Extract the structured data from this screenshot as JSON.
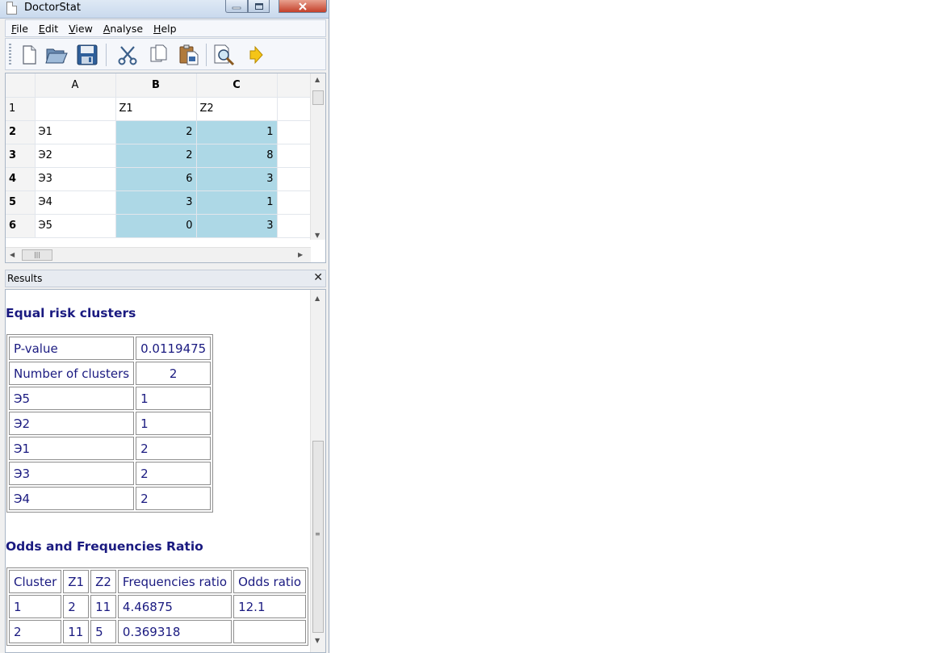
{
  "window": {
    "title": "DoctorStat"
  },
  "menu": {
    "items": [
      {
        "key": "F",
        "rest": "ile"
      },
      {
        "key": "E",
        "rest": "dit"
      },
      {
        "key": "V",
        "rest": "iew"
      },
      {
        "key": "A",
        "rest": "nalyse"
      },
      {
        "key": "H",
        "rest": "elp"
      }
    ]
  },
  "toolbar": {
    "buttons": [
      "new-file-icon",
      "open-folder-icon",
      "save-icon",
      "cut-icon",
      "copy-icon",
      "paste-icon",
      "print-preview-icon",
      "arrow-right-icon"
    ]
  },
  "grid": {
    "columns": [
      "A",
      "B",
      "C"
    ],
    "rows": [
      {
        "num": "1",
        "a": "",
        "b": "Z1",
        "c": "Z2"
      },
      {
        "num": "2",
        "a": "Э1",
        "b": "2",
        "c": "1"
      },
      {
        "num": "3",
        "a": "Э2",
        "b": "2",
        "c": "8"
      },
      {
        "num": "4",
        "a": "Э3",
        "b": "6",
        "c": "3"
      },
      {
        "num": "5",
        "a": "Э4",
        "b": "3",
        "c": "1"
      },
      {
        "num": "6",
        "a": "Э5",
        "b": "0",
        "c": "3"
      }
    ],
    "selection_color": "#add8e6"
  },
  "results": {
    "title": "Results",
    "close": "✕",
    "heading1": "Equal risk clusters",
    "table1": [
      {
        "label": "P-value",
        "value": "0.0119475"
      },
      {
        "label": "Number of clusters",
        "value": "2"
      },
      {
        "label": "Э5",
        "value": "1"
      },
      {
        "label": "Э2",
        "value": "1"
      },
      {
        "label": "Э1",
        "value": "2"
      },
      {
        "label": "Э3",
        "value": "2"
      },
      {
        "label": "Э4",
        "value": "2"
      }
    ],
    "heading2": "Odds and Frequencies Ratio",
    "table2": {
      "headers": [
        "Cluster",
        "Z1",
        "Z2",
        "Frequencies ratio",
        "Odds ratio"
      ],
      "rows": [
        [
          "1",
          "2",
          "11",
          "4.46875",
          "12.1"
        ],
        [
          "2",
          "11",
          "5",
          "0.369318",
          ""
        ]
      ]
    },
    "text_color": "#1a1a80"
  }
}
